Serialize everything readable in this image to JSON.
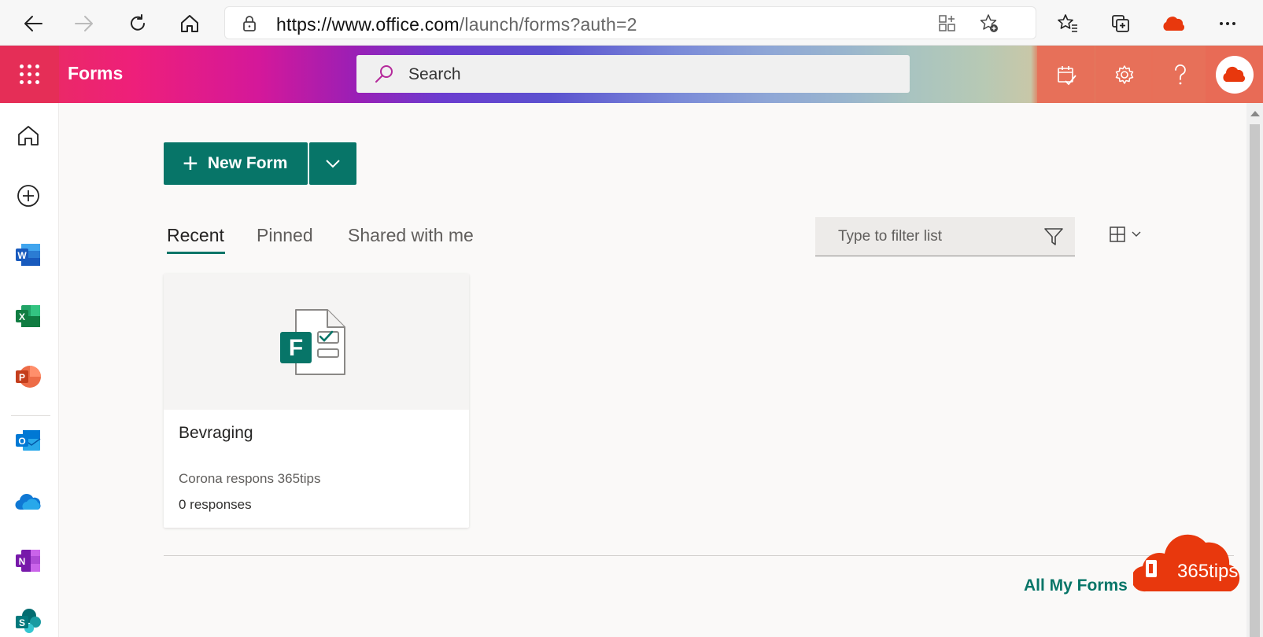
{
  "browser": {
    "url_host": "https://www.office.com",
    "url_path": "/launch/forms?auth=2"
  },
  "header": {
    "app_name": "Forms",
    "search_placeholder": "Search"
  },
  "toolbar": {
    "new_form_label": "New Form"
  },
  "tabs": [
    {
      "label": "Recent",
      "active": true
    },
    {
      "label": "Pinned",
      "active": false
    },
    {
      "label": "Shared with me",
      "active": false
    }
  ],
  "filter": {
    "placeholder": "Type to filter list"
  },
  "forms": [
    {
      "title": "Bevraging",
      "description": "Corona respons 365tips",
      "responses": "0 responses"
    }
  ],
  "footer": {
    "all_forms_label": "All My Forms",
    "arrow": "→"
  },
  "watermark": {
    "text": "365tips"
  },
  "colors": {
    "accent": "#077568",
    "header_pink": "#e52e57",
    "watermark_red": "#e8380d"
  },
  "rail_icons": [
    "home-icon",
    "create-icon",
    "word-icon",
    "excel-icon",
    "powerpoint-icon",
    "outlook-icon",
    "onedrive-icon",
    "onenote-icon",
    "sharepoint-icon"
  ]
}
